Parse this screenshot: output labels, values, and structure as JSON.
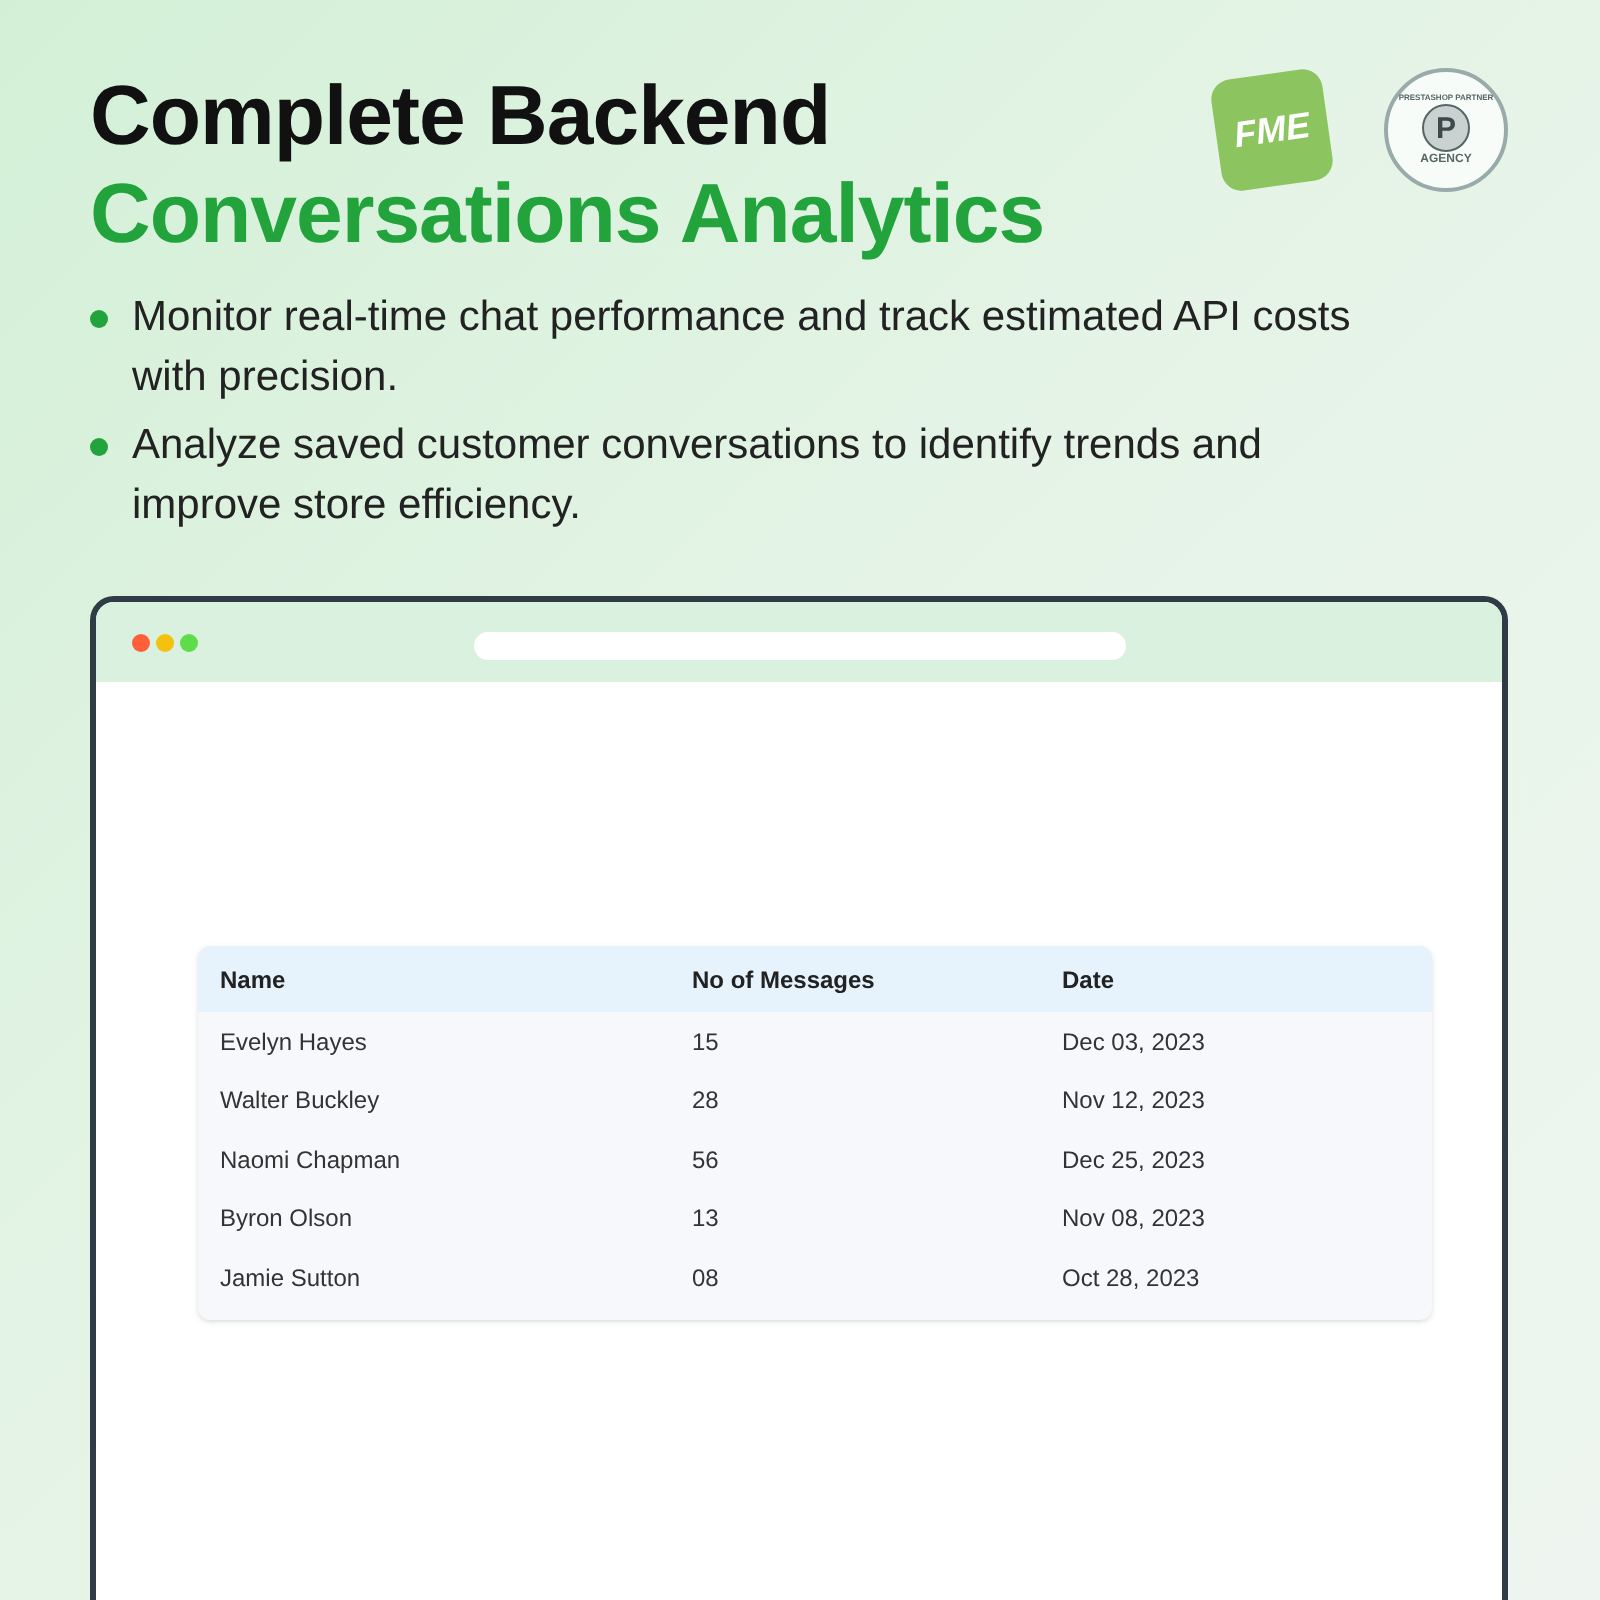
{
  "heading": {
    "line_1": "Complete Backend",
    "line_2": "Conversations Analytics"
  },
  "logos": {
    "fme": "FME",
    "partner_ring": "PRESTASHOP PARTNER",
    "partner_letter": "P",
    "partner_agency": "AGENCY"
  },
  "bullets": [
    "Monitor real-time chat performance and track estimated API costs with precision.",
    "Analyze saved customer conversations to identify trends and improve store efficiency."
  ],
  "table": {
    "columns": [
      "Name",
      "No of Messages",
      "Date"
    ],
    "rows": [
      [
        "Evelyn Hayes",
        "15",
        "Dec 03, 2023"
      ],
      [
        "Walter Buckley",
        "28",
        "Nov 12, 2023"
      ],
      [
        "Naomi Chapman",
        "56",
        "Dec 25, 2023"
      ],
      [
        "Byron Olson",
        "13",
        "Nov 08, 2023"
      ],
      [
        "Jamie Sutton",
        "08",
        "Oct 28, 2023"
      ]
    ]
  }
}
